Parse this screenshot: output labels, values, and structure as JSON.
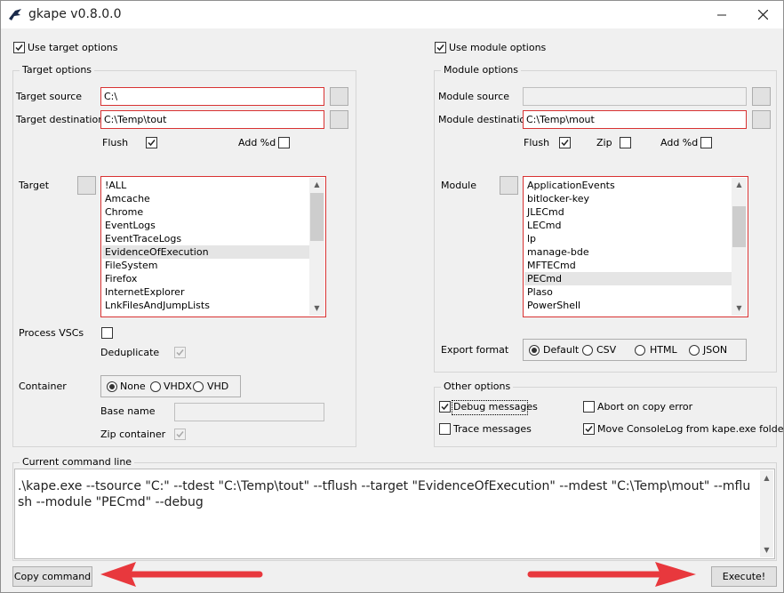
{
  "window": {
    "title": "gkape v0.8.0.0"
  },
  "left": {
    "use_target_options": "Use target options",
    "group_title": "Target options",
    "target_source_label": "Target source",
    "target_source_value": "C:\\",
    "target_destination_label": "Target destination",
    "target_destination_value": "C:\\Temp\\tout",
    "flush_label": "Flush",
    "add_d_label": "Add %d",
    "target_label": "Target",
    "targets": [
      "!ALL",
      "Amcache",
      "Chrome",
      "EventLogs",
      "EventTraceLogs",
      "EvidenceOfExecution",
      "FileSystem",
      "Firefox",
      "InternetExplorer",
      "LnkFilesAndJumpLists"
    ],
    "selected_target": "EvidenceOfExecution",
    "process_vscs_label": "Process VSCs",
    "deduplicate_label": "Deduplicate",
    "container_label": "Container",
    "container_options": [
      "None",
      "VHDX",
      "VHD"
    ],
    "container_selected": "None",
    "base_name_label": "Base name",
    "base_name_value": "",
    "zip_container_label": "Zip container"
  },
  "right": {
    "use_module_options": "Use module options",
    "group_title": "Module options",
    "module_source_label": "Module source",
    "module_source_value": "",
    "module_destination_label": "Module destination",
    "module_destination_value": "C:\\Temp\\mout",
    "flush_label": "Flush",
    "zip_label": "Zip",
    "add_d_label": "Add %d",
    "module_label": "Module",
    "modules": [
      "ApplicationEvents",
      "bitlocker-key",
      "JLECmd",
      "LECmd",
      "lp",
      "manage-bde",
      "MFTECmd",
      "PECmd",
      "Plaso",
      "PowerShell"
    ],
    "selected_module": "PECmd",
    "export_format_label": "Export format",
    "export_formats": [
      "Default",
      "CSV",
      "HTML",
      "JSON"
    ],
    "export_selected": "Default"
  },
  "other": {
    "group_title": "Other options",
    "debug_messages": "Debug messages",
    "trace_messages": "Trace messages",
    "abort_on_copy_error": "Abort on copy error",
    "move_consolelog": "Move ConsoleLog from kape.exe folder"
  },
  "command": {
    "group_title": "Current command line",
    "text": ".\\kape.exe --tsource \"C:\" --tdest \"C:\\Temp\\tout\" --tflush --target \"EvidenceOfExecution\" --mdest \"C:\\Temp\\mout\" --mflush --module \"PECmd\" --debug"
  },
  "buttons": {
    "copy_command": "Copy command",
    "execute": "Execute!"
  },
  "colors": {
    "accent_red": "#d83232",
    "annotation_arrow": "#e8383d"
  }
}
